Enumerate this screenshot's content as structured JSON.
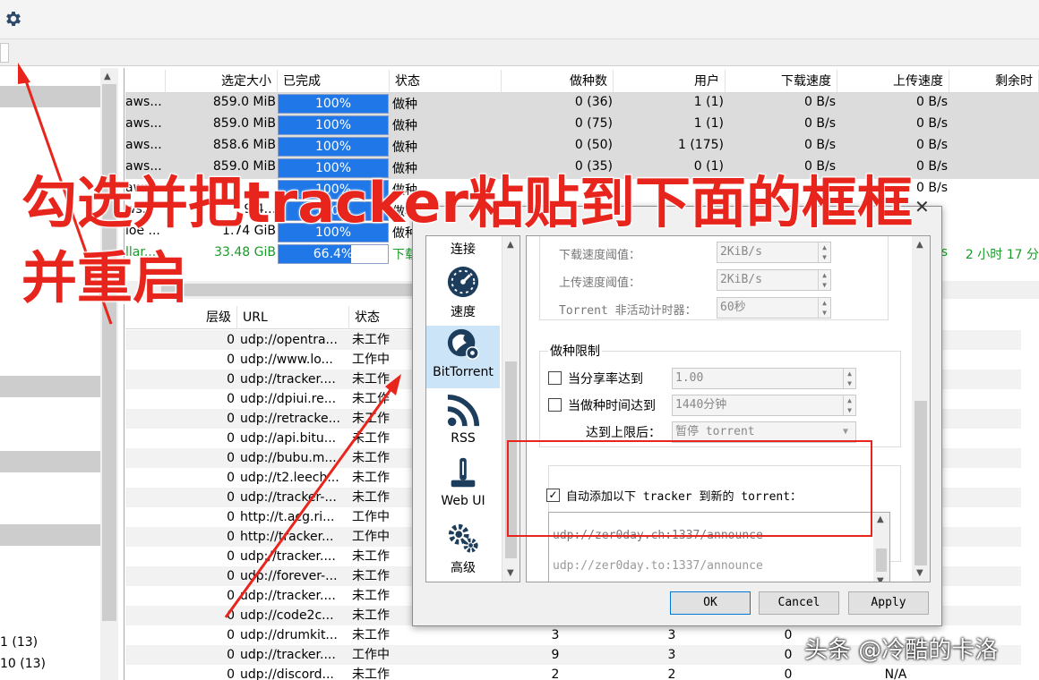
{
  "main_table": {
    "headers": [
      "选定大小",
      "已完成",
      "状态",
      "做种数",
      "用户",
      "下载速度",
      "上传速度",
      "剩余时"
    ],
    "rows": [
      {
        "name": "aws...",
        "size": "859.0 MiB",
        "progress": "100%",
        "progress_value": 100,
        "status": "做种",
        "seeds": "0 (36)",
        "peers": "1 (1)",
        "down": "0 B/s",
        "up": "0 B/s",
        "eta": ""
      },
      {
        "name": "aws...",
        "size": "859.0 MiB",
        "progress": "100%",
        "progress_value": 100,
        "status": "做种",
        "seeds": "0 (75)",
        "peers": "1 (1)",
        "down": "0 B/s",
        "up": "0 B/s",
        "eta": ""
      },
      {
        "name": "aws...",
        "size": "858.6 MiB",
        "progress": "100%",
        "progress_value": 100,
        "status": "做种",
        "seeds": "0 (50)",
        "peers": "1 (175)",
        "down": "0 B/s",
        "up": "0 B/s",
        "eta": ""
      },
      {
        "name": "aws...",
        "size": "859.0 MiB",
        "progress": "100%",
        "progress_value": 100,
        "status": "做种",
        "seeds": "0 (35)",
        "peers": "0 (1)",
        "down": "0 B/s",
        "up": "0 B/s",
        "eta": ""
      },
      {
        "name": "aws...",
        "size": "",
        "progress": "100%",
        "progress_value": 100,
        "status": "做种",
        "seeds": "",
        "peers": "",
        "down": "",
        "up": "0 B/s",
        "eta": ""
      },
      {
        "name": "ws...",
        "size": "9.4...",
        "progress": "100%",
        "progress_value": 100,
        "status": "做种",
        "seeds": "",
        "peers": "",
        "down": "",
        "up": "",
        "eta": ""
      },
      {
        "name": "loe ...",
        "size": "1.74 GiB",
        "progress": "100%",
        "progress_value": 100,
        "status": "做种",
        "seeds": "",
        "peers": "",
        "down": "",
        "up": "",
        "eta": ""
      },
      {
        "name": "llar...",
        "size": "33.48 GiB",
        "progress": "66.4%",
        "progress_value": 66.4,
        "status": "下载",
        "seeds": "",
        "peers": "",
        "down": "",
        "up": "s",
        "eta": "2 小时 17 分"
      }
    ]
  },
  "tracker_table": {
    "headers": [
      "层级",
      "URL",
      "状态"
    ],
    "rows": [
      {
        "tier": "0",
        "url": "udp://opentra...",
        "status": "未工作",
        "c1": "",
        "c2": "",
        "c3": "",
        "c4": ""
      },
      {
        "tier": "0",
        "url": "udp://www.lo...",
        "status": "工作中",
        "c1": "",
        "c2": "",
        "c3": "",
        "c4": ""
      },
      {
        "tier": "0",
        "url": "udp://tracker....",
        "status": "未工作",
        "c1": "",
        "c2": "",
        "c3": "",
        "c4": ""
      },
      {
        "tier": "0",
        "url": "udp://dpiui.re...",
        "status": "未工作",
        "c1": "",
        "c2": "",
        "c3": "",
        "c4": ""
      },
      {
        "tier": "0",
        "url": "udp://retracke...",
        "status": "未工作",
        "c1": "",
        "c2": "",
        "c3": "",
        "c4": ""
      },
      {
        "tier": "0",
        "url": "udp://api.bitu...",
        "status": "未工作",
        "c1": "",
        "c2": "",
        "c3": "",
        "c4": ""
      },
      {
        "tier": "0",
        "url": "udp://bubu.m...",
        "status": "未工作",
        "c1": "",
        "c2": "",
        "c3": "",
        "c4": ""
      },
      {
        "tier": "0",
        "url": "udp://t2.leech...",
        "status": "未工作",
        "c1": "",
        "c2": "",
        "c3": "",
        "c4": ""
      },
      {
        "tier": "0",
        "url": "udp://tracker-...",
        "status": "未工作",
        "c1": "",
        "c2": "",
        "c3": "",
        "c4": ""
      },
      {
        "tier": "0",
        "url": "http://t.acg.ri...",
        "status": "工作中",
        "c1": "",
        "c2": "",
        "c3": "",
        "c4": ""
      },
      {
        "tier": "0",
        "url": "http://tracker...",
        "status": "工作中",
        "c1": "",
        "c2": "",
        "c3": "",
        "c4": ""
      },
      {
        "tier": "0",
        "url": "udp://tracker....",
        "status": "未工作",
        "c1": "",
        "c2": "",
        "c3": "",
        "c4": ""
      },
      {
        "tier": "0",
        "url": "udp://forever-...",
        "status": "未工作",
        "c1": "",
        "c2": "",
        "c3": "",
        "c4": ""
      },
      {
        "tier": "0",
        "url": "udp://tracker....",
        "status": "未工作",
        "c1": "",
        "c2": "",
        "c3": "",
        "c4": ""
      },
      {
        "tier": "0",
        "url": "udp://code2c...",
        "status": "未工作",
        "c1": "",
        "c2": "",
        "c3": "",
        "c4": ""
      },
      {
        "tier": "0",
        "url": "udp://drumkit...",
        "status": "未工作",
        "c1": "3",
        "c2": "3",
        "c3": "0",
        "c4": ""
      },
      {
        "tier": "0",
        "url": "udp://tracker....",
        "status": "工作中",
        "c1": "9",
        "c2": "3",
        "c3": "0",
        "c4": ""
      },
      {
        "tier": "0",
        "url": "udp://discord...",
        "status": "未工作",
        "c1": "2",
        "c2": "2",
        "c3": "0",
        "c4": "N/A"
      }
    ]
  },
  "sidebar": {
    "items": [
      "1 (13)",
      "10 (13)"
    ]
  },
  "dialog": {
    "close": "✕",
    "nav": [
      {
        "label": "连接",
        "icon": "connection-icon"
      },
      {
        "label": "速度",
        "icon": "speedometer-icon"
      },
      {
        "label": "BitTorrent",
        "icon": "bittorrent-icon"
      },
      {
        "label": "RSS",
        "icon": "rss-icon"
      },
      {
        "label": "Web UI",
        "icon": "webui-icon"
      },
      {
        "label": "高级",
        "icon": "gears-icon"
      }
    ],
    "slow_dl_label": "下载速度阈值：",
    "slow_dl_value": "2KiB/s",
    "slow_ul_label": "上传速度阈值：",
    "slow_ul_value": "2KiB/s",
    "inactive_label": "Torrent 非活动计时器：",
    "inactive_value": "60秒",
    "seed_limit_title": "做种限制",
    "ratio_label": "当分享率达到",
    "ratio_value": "1.00",
    "time_label": "当做种时间达到",
    "time_value": "1440分钟",
    "after_label": "达到上限后：",
    "after_value": "暂停 torrent",
    "auto_tracker_label": "自动添加以下 tracker 到新的 torrent：",
    "tracker_lines": [
      "udp://zer0day.ch:1337/announce",
      "udp://zer0day.to:1337/announce"
    ],
    "ok": "OK",
    "cancel": "Cancel",
    "apply": "Apply"
  },
  "annotation": {
    "line1": "勾选并把tracker粘贴到下面的框框",
    "line2": "并重启",
    "color": "#e8251d"
  },
  "watermark": "头条 @冷酷的卡洛",
  "icons": {
    "toolbar": "gear-icon"
  }
}
